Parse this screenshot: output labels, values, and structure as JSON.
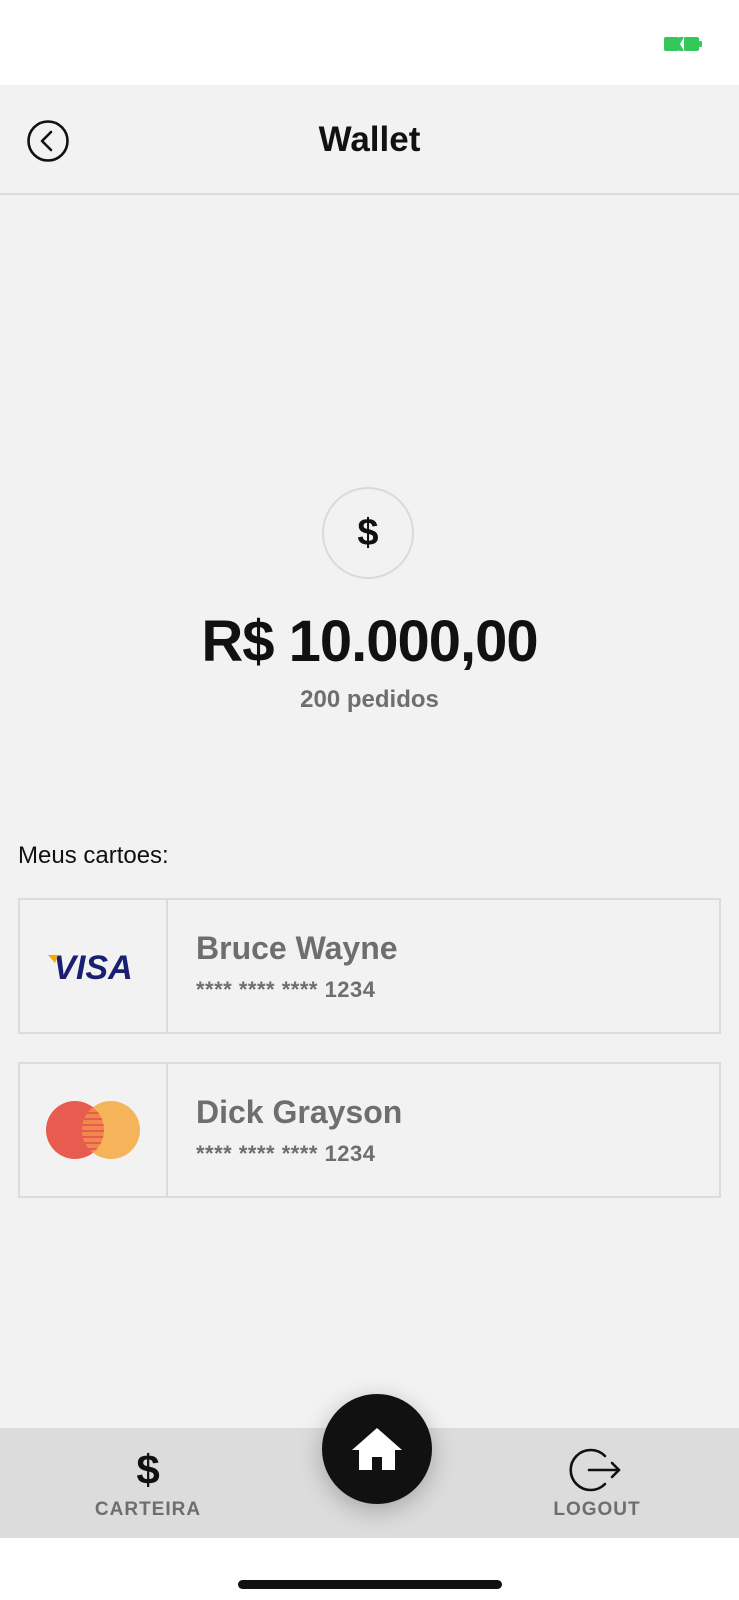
{
  "header": {
    "title": "Wallet"
  },
  "balance": {
    "currency_symbol": "$",
    "amount": "R$ 10.000,00",
    "orders": "200 pedidos"
  },
  "cards_section": {
    "label": "Meus cartoes:",
    "cards": [
      {
        "brand": "VISA",
        "holder": "Bruce Wayne",
        "number": "**** **** **** 1234"
      },
      {
        "brand": "mastercard",
        "holder": "Dick Grayson",
        "number": "**** **** **** 1234"
      }
    ]
  },
  "bottom_nav": {
    "wallet": {
      "icon": "$",
      "label": "CARTEIRA"
    },
    "logout": {
      "label": "LOGOUT"
    }
  },
  "colors": {
    "battery": "#34c759",
    "visa_blue": "#1a1f71",
    "visa_gold": "#f7a800",
    "mc_red": "#e85b4f",
    "mc_orange": "#f5b45a"
  }
}
